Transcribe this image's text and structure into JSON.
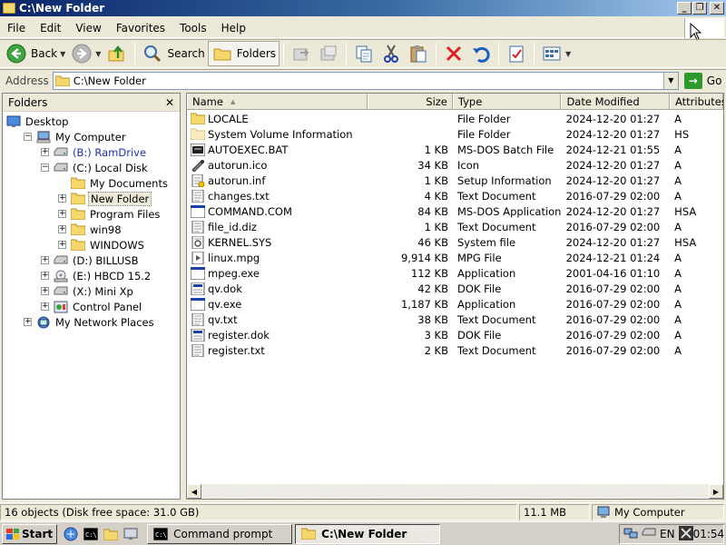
{
  "window": {
    "title": "C:\\New Folder",
    "controls": {
      "minimize": "_",
      "maximize": "❐",
      "close": "✕"
    }
  },
  "menu": [
    "File",
    "Edit",
    "View",
    "Favorites",
    "Tools",
    "Help"
  ],
  "toolbar": {
    "back_label": "Back",
    "search_label": "Search",
    "folders_label": "Folders"
  },
  "address": {
    "label": "Address",
    "value": "C:\\New Folder",
    "go_label": "Go"
  },
  "folders_pane": {
    "title": "Folders",
    "close": "✕",
    "tree": [
      {
        "label": "Desktop",
        "level": 0,
        "expander": "",
        "icon": "desktop-icon"
      },
      {
        "label": "My Computer",
        "level": 1,
        "expander": "−",
        "icon": "computer-icon"
      },
      {
        "label": "(B:) RamDrive",
        "level": 2,
        "expander": "+",
        "icon": "drive-icon",
        "blue": true
      },
      {
        "label": "(C:) Local Disk",
        "level": 2,
        "expander": "−",
        "icon": "drive-icon"
      },
      {
        "label": "My Documents",
        "level": 3,
        "expander": "",
        "icon": "folder-icon"
      },
      {
        "label": "New Folder",
        "level": 3,
        "expander": "+",
        "icon": "folder-icon",
        "selected": true
      },
      {
        "label": "Program Files",
        "level": 3,
        "expander": "+",
        "icon": "folder-icon"
      },
      {
        "label": "win98",
        "level": 3,
        "expander": "+",
        "icon": "folder-icon"
      },
      {
        "label": "WINDOWS",
        "level": 3,
        "expander": "+",
        "icon": "folder-icon"
      },
      {
        "label": "(D:) BILLUSB",
        "level": 2,
        "expander": "+",
        "icon": "drive-icon"
      },
      {
        "label": "(E:) HBCD 15.2",
        "level": 2,
        "expander": "+",
        "icon": "cd-drive-icon"
      },
      {
        "label": "(X:) Mini Xp",
        "level": 2,
        "expander": "+",
        "icon": "drive-icon"
      },
      {
        "label": "Control Panel",
        "level": 2,
        "expander": "+",
        "icon": "control-panel-icon"
      },
      {
        "label": "My Network Places",
        "level": 1,
        "expander": "+",
        "icon": "network-icon"
      }
    ]
  },
  "file_list": {
    "columns": [
      "Name",
      "Size",
      "Type",
      "Date Modified",
      "Attributes"
    ],
    "sort_indicator": "▲",
    "rows": [
      {
        "name": "LOCALE",
        "size": "",
        "type": "File Folder",
        "date": "2024-12-20 01:27",
        "attr": "A",
        "icon": "folder"
      },
      {
        "name": "System Volume Information",
        "size": "",
        "type": "File Folder",
        "date": "2024-12-20 01:27",
        "attr": "HS",
        "icon": "folder-hidden"
      },
      {
        "name": "AUTOEXEC.BAT",
        "size": "1 KB",
        "type": "MS-DOS Batch File",
        "date": "2024-12-21 01:55",
        "attr": "A",
        "icon": "bat"
      },
      {
        "name": "autorun.ico",
        "size": "34 KB",
        "type": "Icon",
        "date": "2024-12-20 01:27",
        "attr": "A",
        "icon": "ico"
      },
      {
        "name": "autorun.inf",
        "size": "1 KB",
        "type": "Setup Information",
        "date": "2024-12-20 01:27",
        "attr": "A",
        "icon": "inf"
      },
      {
        "name": "changes.txt",
        "size": "4 KB",
        "type": "Text Document",
        "date": "2016-07-29 02:00",
        "attr": "A",
        "icon": "txt"
      },
      {
        "name": "COMMAND.COM",
        "size": "84 KB",
        "type": "MS-DOS Application",
        "date": "2024-12-20 01:27",
        "attr": "HSA",
        "icon": "app"
      },
      {
        "name": "file_id.diz",
        "size": "1 KB",
        "type": "Text Document",
        "date": "2016-07-29 02:00",
        "attr": "A",
        "icon": "txt"
      },
      {
        "name": "KERNEL.SYS",
        "size": "46 KB",
        "type": "System file",
        "date": "2024-12-20 01:27",
        "attr": "HSA",
        "icon": "sys"
      },
      {
        "name": "linux.mpg",
        "size": "9,914 KB",
        "type": "MPG File",
        "date": "2024-12-21 01:24",
        "attr": "A",
        "icon": "mpg"
      },
      {
        "name": "mpeg.exe",
        "size": "112 KB",
        "type": "Application",
        "date": "2001-04-16 01:10",
        "attr": "A",
        "icon": "app"
      },
      {
        "name": "qv.dok",
        "size": "42 KB",
        "type": "DOK File",
        "date": "2016-07-29 02:00",
        "attr": "A",
        "icon": "dok"
      },
      {
        "name": "qv.exe",
        "size": "1,187 KB",
        "type": "Application",
        "date": "2016-07-29 02:00",
        "attr": "A",
        "icon": "app"
      },
      {
        "name": "qv.txt",
        "size": "38 KB",
        "type": "Text Document",
        "date": "2016-07-29 02:00",
        "attr": "A",
        "icon": "txt"
      },
      {
        "name": "register.dok",
        "size": "3 KB",
        "type": "DOK File",
        "date": "2016-07-29 02:00",
        "attr": "A",
        "icon": "dok"
      },
      {
        "name": "register.txt",
        "size": "2 KB",
        "type": "Text Document",
        "date": "2016-07-29 02:00",
        "attr": "A",
        "icon": "txt"
      }
    ]
  },
  "status": {
    "objects": "16 objects (Disk free space: 31.0 GB)",
    "size": "11.1 MB",
    "zone": "My Computer"
  },
  "taskbar": {
    "start_label": "Start",
    "tasks": [
      {
        "label": "Command prompt",
        "active": false
      },
      {
        "label": "C:\\New Folder",
        "active": true
      }
    ],
    "language": "EN",
    "clock": "01:54"
  },
  "colors": {
    "title_start": "#0a246a",
    "title_end": "#a6caf0",
    "face": "#ece9d8",
    "folder": "#f5d76e"
  }
}
